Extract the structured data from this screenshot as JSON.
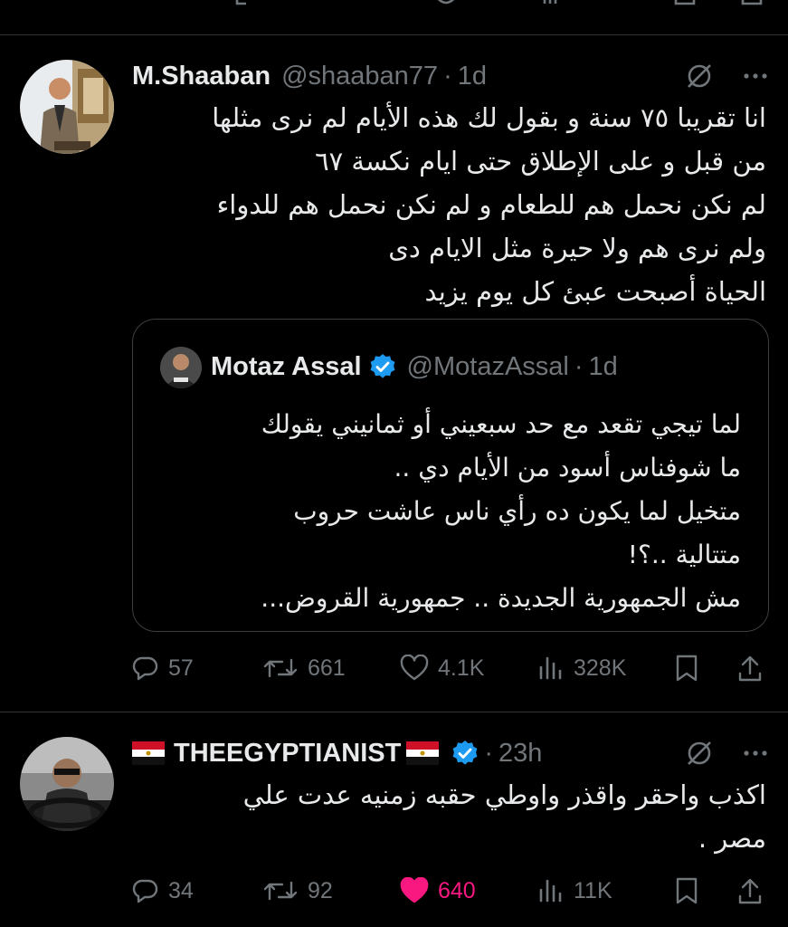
{
  "tweet1": {
    "name": "M.Shaaban",
    "handle": "@shaaban77",
    "time": "1d",
    "text": "انا تقريبا ٧٥ سنة و بقول لك هذه الأيام لم نرى مثلها\nمن قبل و على الإطلاق حتى ايام نكسة ٦٧\nلم نكن نحمل هم للطعام و لم نكن نحمل هم للدواء\nولم نرى هم ولا حيرة مثل الايام دى\nالحياة أصبحت عبئ كل يوم يزيد",
    "quote": {
      "name": "Motaz Assal",
      "handle": "@MotazAssal",
      "time": "1d",
      "text": "لما تيجي تقعد مع حد سبعيني أو ثمانيني يقولك\nما شوفناس أسود من الأيام دي ..\nمتخيل لما يكون ده رأي ناس عاشت حروب\nمتتالية ..؟!\nمش الجمهورية الجديدة .. جمهورية القروض..."
    },
    "replies": "57",
    "reposts": "661",
    "likes": "4.1K",
    "views": "328K"
  },
  "tweet2": {
    "name": "THEEGYPTIANIST",
    "time": "23h",
    "text": "اكذب واحقر واقذر واوطي حقبه زمنيه عدت علي\nمصر .",
    "replies": "34",
    "reposts": "92",
    "likes": "640",
    "views": "11K"
  },
  "colors": {
    "background": "#000000",
    "text": "#e7e9ea",
    "secondary": "#71767b",
    "verified": "#1d9bf0",
    "like": "#f91880",
    "divider": "#2f3336"
  },
  "icons": [
    "reply-icon",
    "repost-icon",
    "like-icon",
    "views-icon",
    "bookmark-icon",
    "share-icon",
    "grok-icon",
    "more-icon",
    "verified-icon",
    "egypt-flag-icon"
  ]
}
